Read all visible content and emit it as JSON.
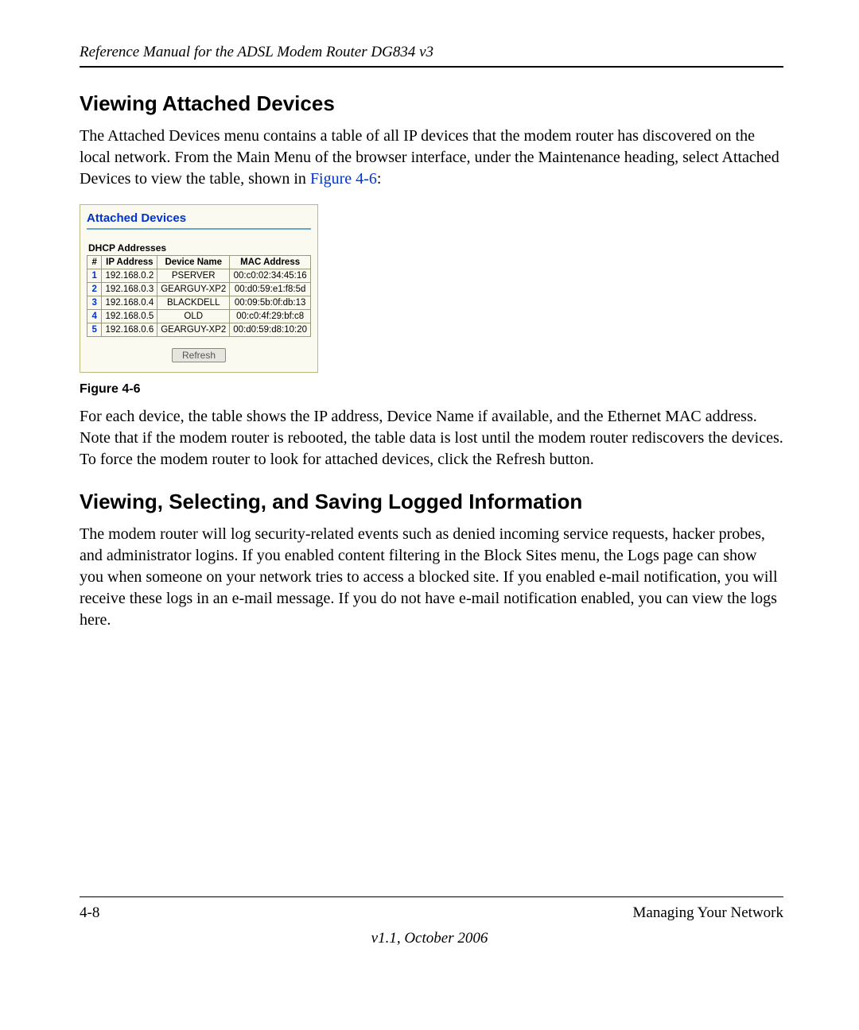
{
  "header": {
    "running": "Reference Manual for the ADSL Modem Router DG834 v3"
  },
  "section1": {
    "title": "Viewing Attached Devices",
    "para1_a": "The Attached Devices menu contains a table of all IP devices that the modem router has discovered on the local network. From the Main Menu of the browser interface, under the Maintenance heading, select Attached Devices to view the table, shown in ",
    "para1_link": "Figure 4-6",
    "para1_b": ":"
  },
  "shot": {
    "title": "Attached Devices",
    "subtitle": "DHCP Addresses",
    "headers": {
      "num": "#",
      "ip": "IP Address",
      "name": "Device Name",
      "mac": "MAC Address"
    },
    "rows": [
      {
        "n": "1",
        "ip": "192.168.0.2",
        "name": "PSERVER",
        "mac": "00:c0:02:34:45:16"
      },
      {
        "n": "2",
        "ip": "192.168.0.3",
        "name": "GEARGUY-XP2",
        "mac": "00:d0:59:e1:f8:5d"
      },
      {
        "n": "3",
        "ip": "192.168.0.4",
        "name": "BLACKDELL",
        "mac": "00:09:5b:0f:db:13"
      },
      {
        "n": "4",
        "ip": "192.168.0.5",
        "name": "OLD",
        "mac": "00:c0:4f:29:bf:c8"
      },
      {
        "n": "5",
        "ip": "192.168.0.6",
        "name": "GEARGUY-XP2",
        "mac": "00:d0:59:d8:10:20"
      }
    ],
    "refresh": "Refresh"
  },
  "fig_caption": "Figure 4-6",
  "section1_para2": "For each device, the table shows the IP address, Device Name if available, and the Ethernet MAC address. Note that if the modem router is rebooted, the table data is lost until the modem router rediscovers the devices. To force the modem router to look for attached devices, click the Refresh button.",
  "section2": {
    "title": "Viewing, Selecting, and Saving Logged Information",
    "para1": "The modem router will log security-related events such as denied incoming service requests, hacker probes, and administrator logins. If you enabled content filtering in the Block Sites menu, the Logs page can show you when someone on your network tries to access a blocked site. If you enabled e-mail notification, you will receive these logs in an e-mail message. If you do not have e-mail notification enabled, you can view the logs here."
  },
  "footer": {
    "page": "4-8",
    "chapter": "Managing Your Network",
    "version": "v1.1, October 2006"
  }
}
